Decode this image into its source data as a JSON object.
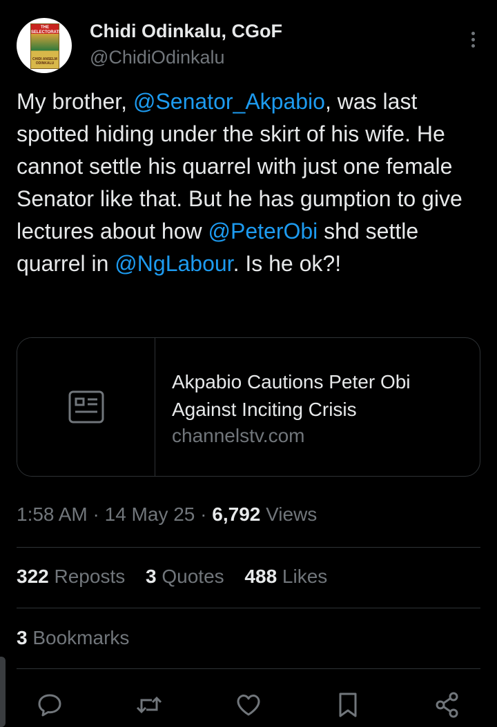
{
  "author": {
    "name": "Chidi Odinkalu, CGoF",
    "handle": "@ChidiOdinkalu",
    "avatar_book_title": "THE SELECTORATE",
    "avatar_book_author": "CHIDI ANSELM ODINKALU"
  },
  "tweet": {
    "segments": [
      {
        "text": "My brother, ",
        "type": "text"
      },
      {
        "text": "@Senator_Akpabio",
        "type": "mention"
      },
      {
        "text": ", was last spotted hiding under the skirt of his wife. He cannot settle his quarrel with just one female Senator like that. But he has gumption to give lectures about how ",
        "type": "text"
      },
      {
        "text": "@PeterObi",
        "type": "mention"
      },
      {
        "text": " shd settle quarrel in ",
        "type": "text"
      },
      {
        "text": "@NgLabour",
        "type": "mention"
      },
      {
        "text": ". Is he ok?!",
        "type": "text"
      }
    ]
  },
  "card": {
    "title": "Akpabio Cautions Peter Obi Against Inciting Crisis",
    "domain": "channelstv.com",
    "icon": "news-article-icon"
  },
  "meta": {
    "time": "1:58 AM",
    "date": "14 May 25",
    "views_count": "6,792",
    "views_label": "Views",
    "separator": "·"
  },
  "stats": {
    "reposts_count": "322",
    "reposts_label": "Reposts",
    "quotes_count": "3",
    "quotes_label": "Quotes",
    "likes_count": "488",
    "likes_label": "Likes",
    "bookmarks_count": "3",
    "bookmarks_label": "Bookmarks"
  },
  "actions": [
    "reply-icon",
    "repost-icon",
    "like-icon",
    "bookmark-icon",
    "share-icon"
  ],
  "colors": {
    "background": "#000000",
    "text": "#e7e9ea",
    "secondary": "#71767b",
    "link": "#1d9bf0",
    "border": "#2f3336"
  }
}
